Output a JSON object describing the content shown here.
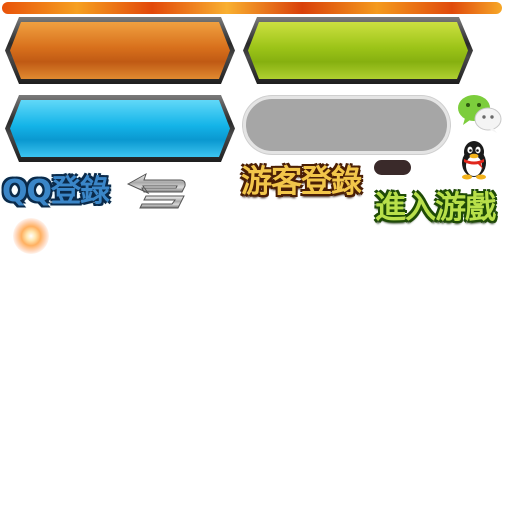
{
  "atlas": {
    "fire_bar": {
      "name": "fire-progress-bar"
    },
    "buttons": [
      {
        "id": "orange",
        "color": "#d8701c"
      },
      {
        "id": "green",
        "color": "#9cc418"
      },
      {
        "id": "blue",
        "color": "#14b4e8"
      },
      {
        "id": "gray",
        "color": "#a6a6a6"
      }
    ],
    "labels": {
      "qq_login": "QQ登錄",
      "guest_login": "游客登錄",
      "enter_game": "進入游戲"
    },
    "icons": [
      "back-arrow-icon",
      "wechat-icon",
      "qq-penguin-icon",
      "glow-particle-icon"
    ]
  }
}
